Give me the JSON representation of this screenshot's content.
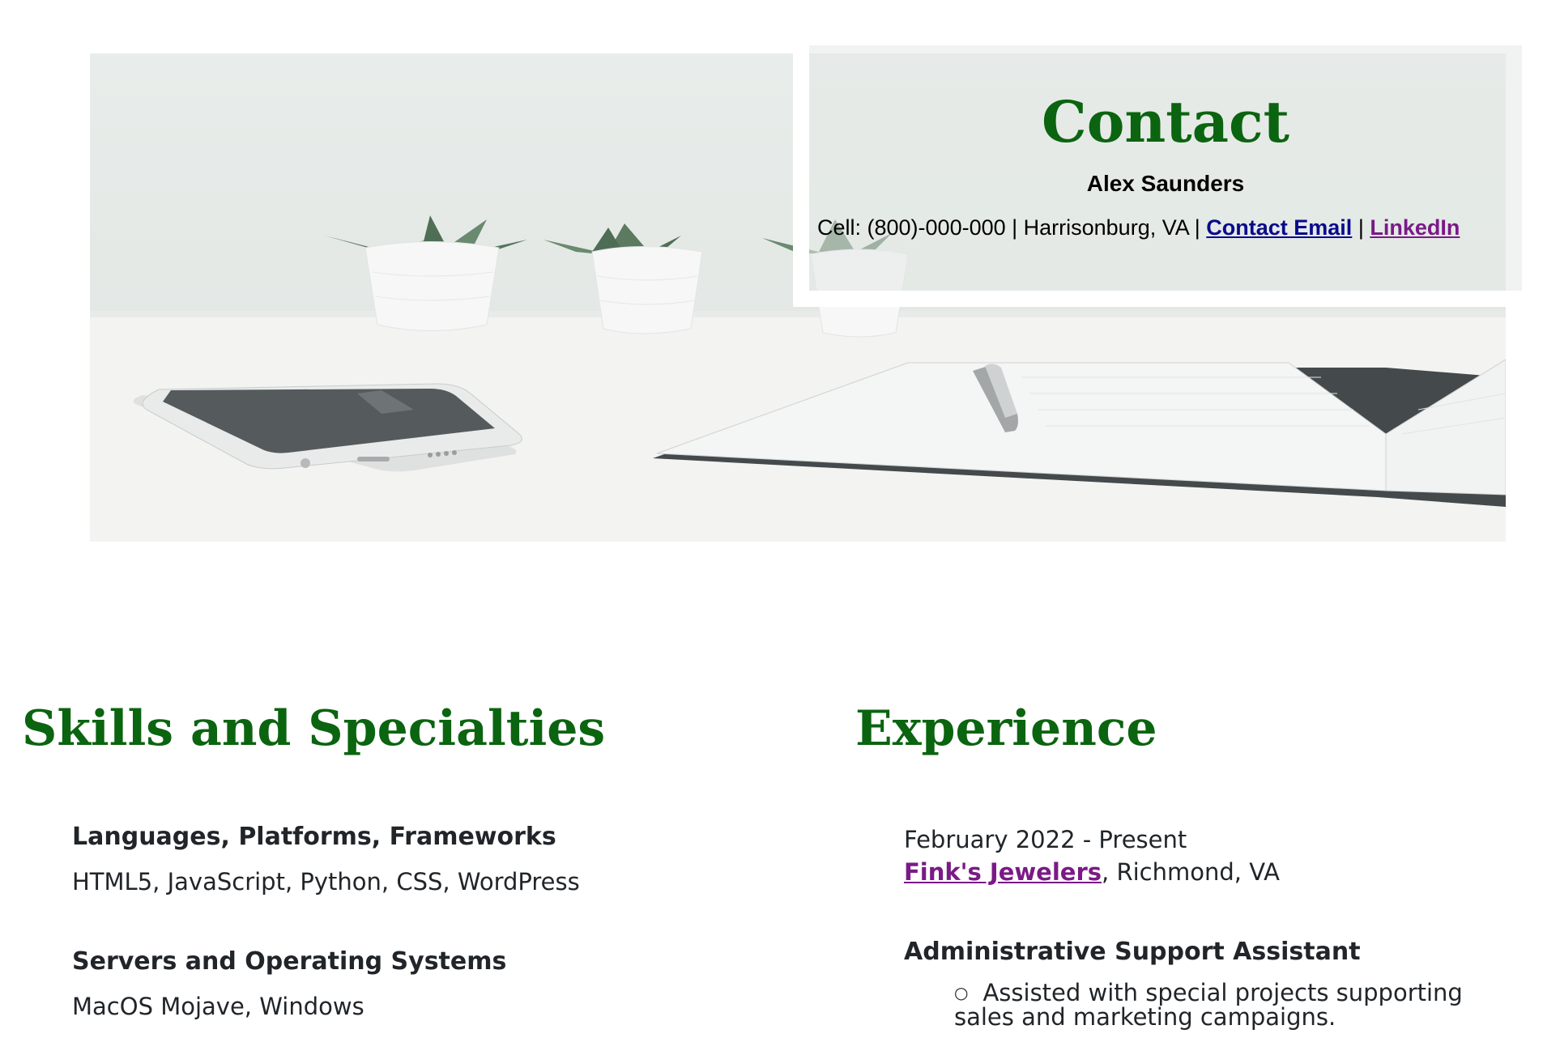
{
  "contact": {
    "title": "Contact",
    "name": "Alex Saunders",
    "details": "Cell: (800)-000-000 | Harrisonburg, VA | ",
    "email_link": "Contact Email",
    "separator": " | ",
    "linkedin_link": "LinkedIn"
  },
  "skills": {
    "title": "Skills and Specialties",
    "groups": [
      {
        "heading": "Languages, Platforms, Frameworks",
        "items": "HTML5, JavaScript, Python, CSS, WordPress"
      },
      {
        "heading": "Servers and Operating Systems",
        "items": "MacOS Mojave, Windows"
      }
    ]
  },
  "experience": {
    "title": "Experience",
    "jobs": [
      {
        "dates": "February 2022 - Present",
        "company": "Fink's Jewelers",
        "location": ", Richmond, VA",
        "role": "Administrative Support Assistant",
        "bullets": [
          "Assisted with special projects supporting sales and marketing campaigns."
        ]
      }
    ]
  },
  "colors": {
    "heading_green": "#0b6410",
    "link_blue": "#0a0a8c",
    "link_purple": "#7a1a86"
  }
}
